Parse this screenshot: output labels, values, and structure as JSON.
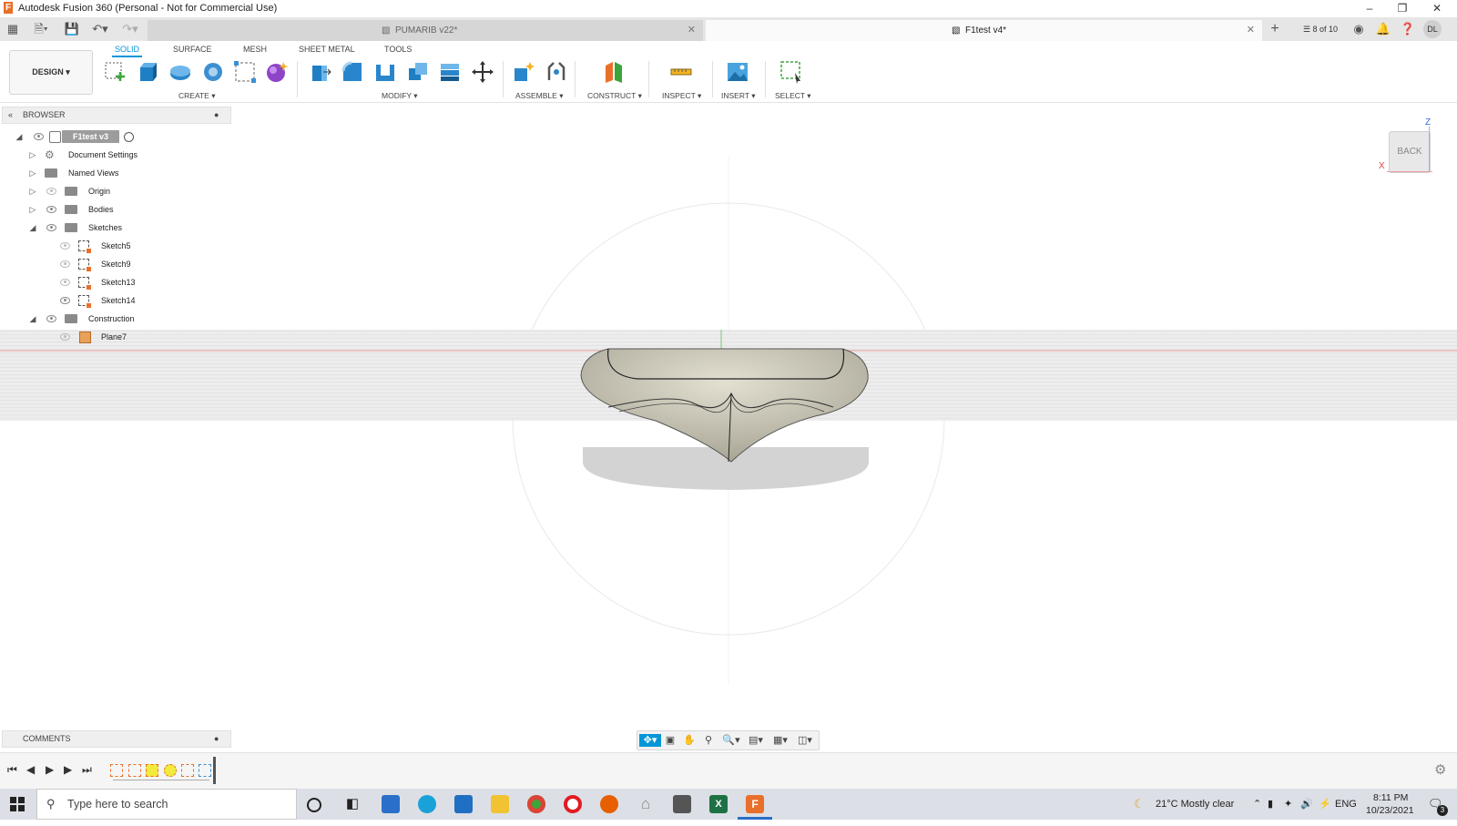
{
  "window": {
    "title": "Autodesk Fusion 360 (Personal - Not for Commercial Use)",
    "app_icon": "F",
    "controls": [
      "minimize-icon",
      "maximize-icon",
      "close-icon"
    ]
  },
  "tabs": {
    "doc1": "PUMARIB v22*",
    "doc2": "F1test v4*",
    "job_status": "8 of 10",
    "user_initials": "DL"
  },
  "toolbar": {
    "workspace_tabs": [
      "SOLID",
      "SURFACE",
      "MESH",
      "SHEET METAL",
      "TOOLS"
    ],
    "active_tab": "SOLID",
    "design_label": "DESIGN",
    "groups": {
      "create": "CREATE",
      "modify": "MODIFY",
      "assemble": "ASSEMBLE",
      "construct": "CONSTRUCT",
      "inspect": "INSPECT",
      "insert": "INSERT",
      "select": "SELECT"
    },
    "tool_icons": [
      "create-sketch-icon",
      "extrude-icon",
      "revolve-icon",
      "sweep-icon",
      "loft-icon",
      "form-icon",
      "press-pull-icon",
      "fillet-icon",
      "shell-icon",
      "combine-icon",
      "offset-face-icon",
      "move-icon",
      "new-component-icon",
      "joint-icon",
      "offset-plane-icon",
      "measure-icon",
      "insert-image-icon",
      "select-window-icon"
    ]
  },
  "browser": {
    "title": "BROWSER",
    "root": "F1test v3",
    "items": [
      {
        "label": "Document Settings",
        "icon": "gear-icon"
      },
      {
        "label": "Named Views",
        "icon": "folder-icon"
      },
      {
        "label": "Origin",
        "icon": "folder-icon"
      },
      {
        "label": "Bodies",
        "icon": "folder-icon"
      },
      {
        "label": "Sketches",
        "icon": "folder-icon"
      },
      {
        "label": "Sketch5",
        "icon": "sketch-icon"
      },
      {
        "label": "Sketch9",
        "icon": "sketch-icon"
      },
      {
        "label": "Sketch13",
        "icon": "sketch-icon"
      },
      {
        "label": "Sketch14",
        "icon": "sketch-icon"
      },
      {
        "label": "Construction",
        "icon": "folder-icon"
      },
      {
        "label": "Plane7",
        "icon": "plane-icon"
      }
    ]
  },
  "viewcube": {
    "face": "BACK",
    "axis_z": "Z",
    "axis_x": "X"
  },
  "comments": {
    "title": "COMMENTS"
  },
  "taskbar": {
    "search_placeholder": "Type here to search",
    "weather": "21°C  Mostly clear",
    "language": "ENG",
    "time": "8:11 PM",
    "date": "10/23/2021",
    "notification_count": "3"
  }
}
